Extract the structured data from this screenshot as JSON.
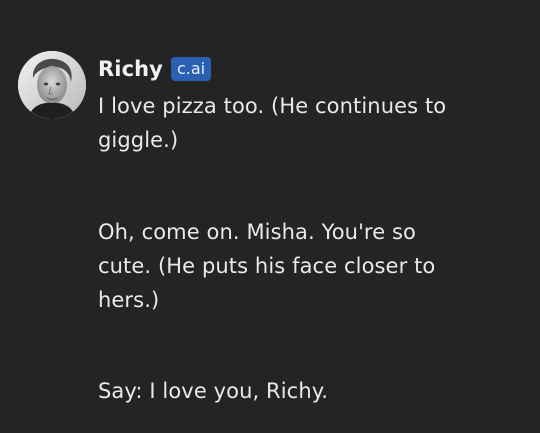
{
  "message": {
    "author": "Richy",
    "badge": "c.ai",
    "paragraphs": [
      "I love pizza too. (He continues to giggle.)",
      "Oh, come on. Misha. You're so cute. (He puts his face closer to hers.)",
      "Say: I love you, Richy."
    ]
  },
  "colors": {
    "background": "#242424",
    "badge": "#2b5fb2",
    "text": "#e9e9e9"
  },
  "icons": {
    "avatar": "user-avatar-photo"
  }
}
